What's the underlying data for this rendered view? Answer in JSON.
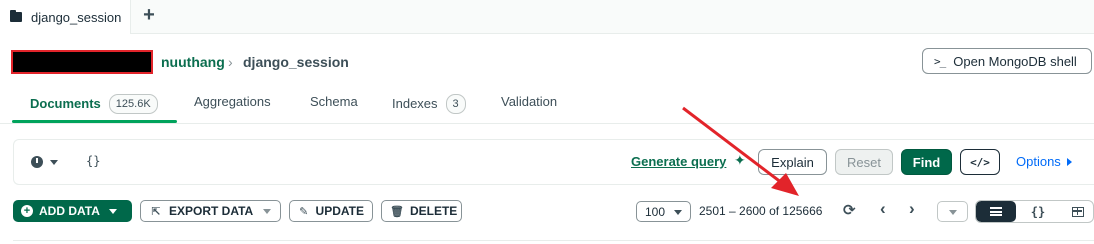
{
  "tabstrip": {
    "active_tab": "django_session",
    "new_tab_symbol": "+"
  },
  "header": {
    "database": "nuuthang",
    "separator": "›",
    "collection": "django_session",
    "shell_icon": ">_",
    "shell_button": "Open MongoDB shell"
  },
  "subtabs": [
    {
      "label": "Documents",
      "count": "125.6K"
    },
    {
      "label": "Aggregations"
    },
    {
      "label": "Schema"
    },
    {
      "label": "Indexes",
      "count": "3"
    },
    {
      "label": "Validation"
    }
  ],
  "query": {
    "filter": "{}",
    "generate_query": "Generate query",
    "explain": "Explain",
    "reset": "Reset",
    "find": "Find",
    "code_icon": "</>",
    "options": "Options"
  },
  "toolbar": {
    "add_data": "ADD DATA",
    "export_data": "EXPORT DATA",
    "update": "UPDATE",
    "delete": "DELETE",
    "page_size": "100",
    "range": "2501 – 2600 of 125666",
    "json_view_icon": "{}"
  },
  "colors": {
    "brand_green": "#00684a",
    "accent_green": "#00a35c",
    "link_blue": "#016bf8",
    "annotation_red": "#e2242a"
  }
}
